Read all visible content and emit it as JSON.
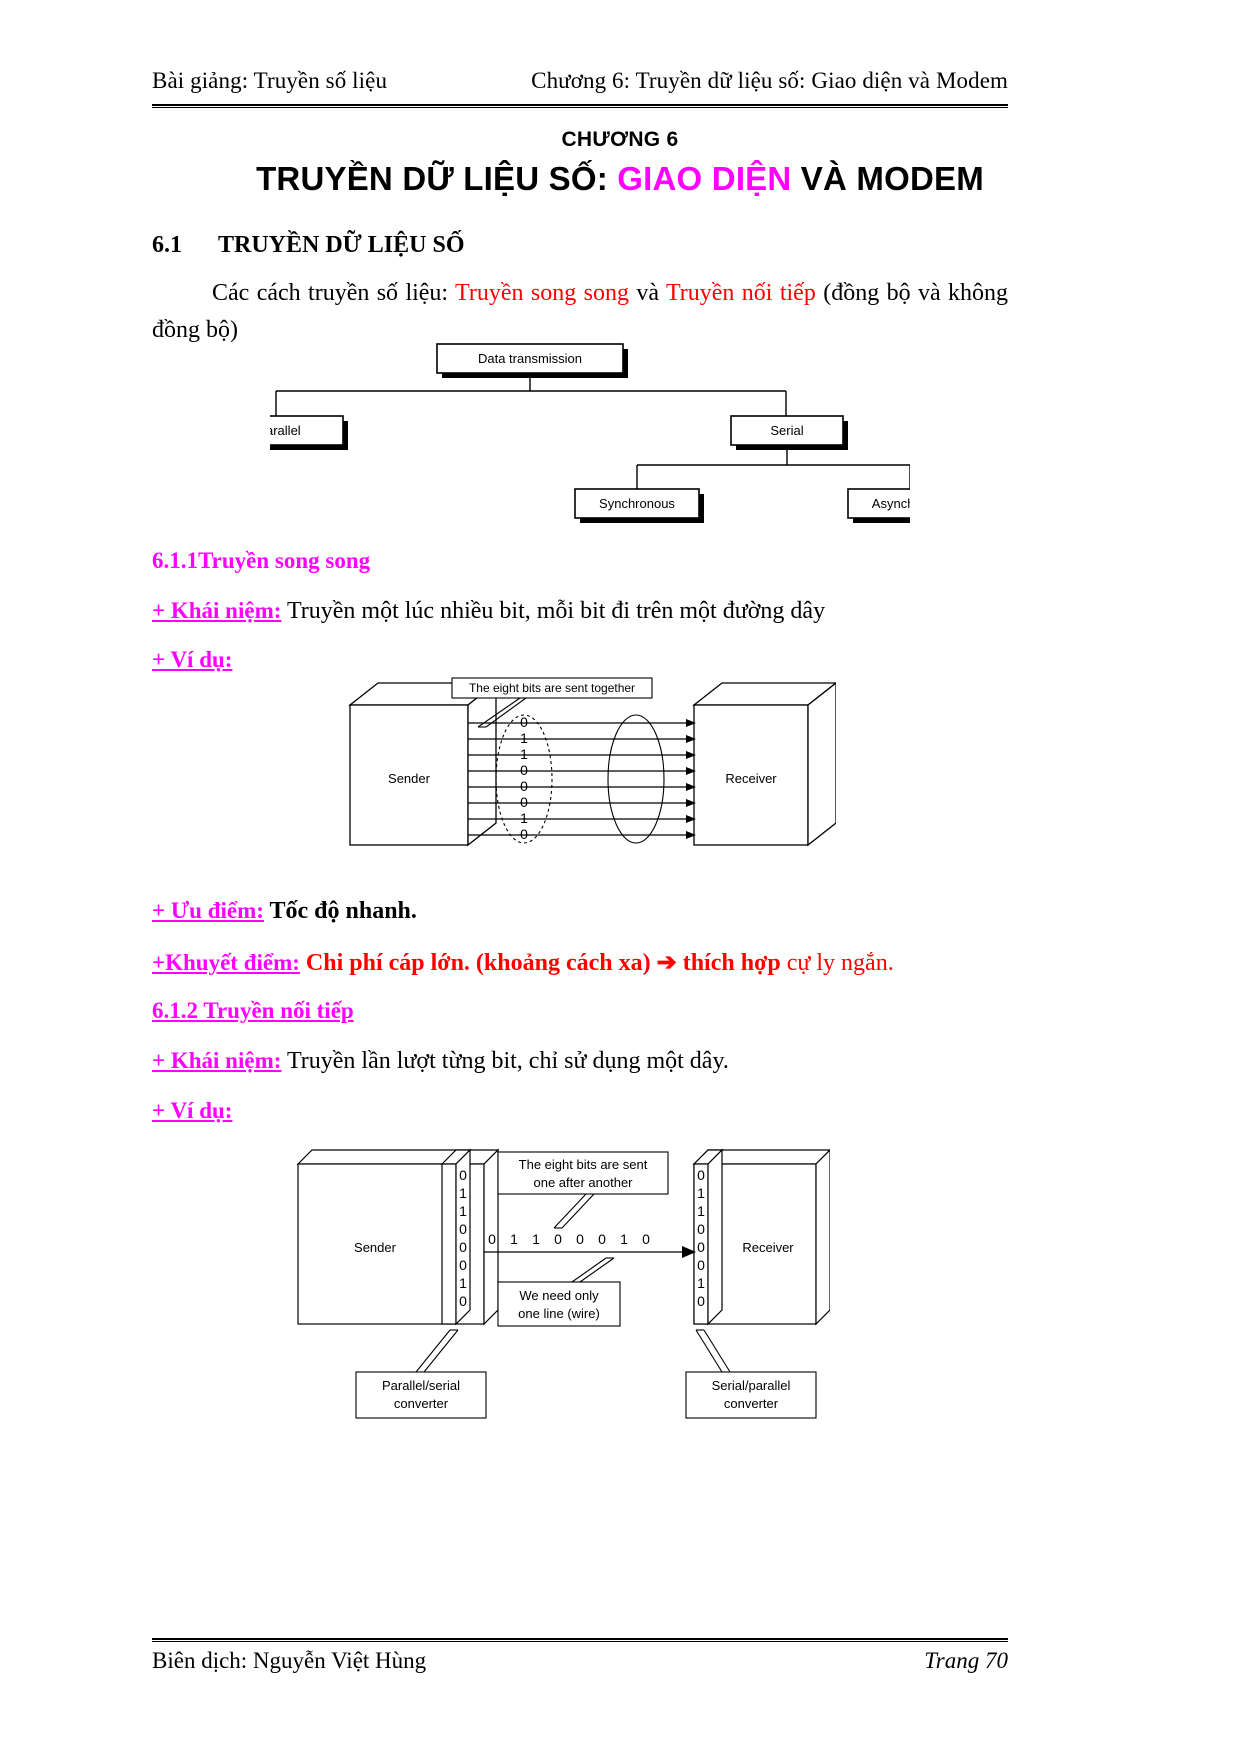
{
  "header": {
    "left": "Bài giảng: Truyền số liệu",
    "right": "Chương 6: Truyền dữ liệu số: Giao diện và Modem"
  },
  "footer": {
    "left": "Biên dịch: Nguyễn Việt Hùng",
    "right": "Trang 70"
  },
  "title": {
    "kicker": "CHƯƠNG 6",
    "main_part1": "TRUYỀN DỮ LIỆU SỐ: ",
    "main_highlight": "GIAO DIỆN",
    "main_part2": " VÀ MODEM",
    "highlight_color": "#ff00ff"
  },
  "section_61": {
    "number": "6.1",
    "heading": "TRUYỀN DỮ LIỆU SỐ",
    "intro_a": "Các cách truyền số liệu: ",
    "intro_red1": "Truyền song song",
    "intro_b": "  và ",
    "intro_red2": "Truyền nối tiếp",
    "intro_c": " (đồng bộ và không đồng bộ)"
  },
  "fig_tree": {
    "root": "Data transmission",
    "left": "Parallel",
    "right": "Serial",
    "child_left": "Synchronous",
    "child_right": "Asynchronous"
  },
  "section_611": {
    "heading": "6.1.1Truyền song song",
    "concept_label": "+ Khái niệm:",
    "concept_text": " Truyền một lúc nhiều bit, mỗi bit đi trên một đường dây",
    "example_label": "+ Ví dụ:",
    "advantage_label": "+ Ưu điểm:",
    "advantage_text": " Tốc độ nhanh.",
    "drawback_label": "+Khuyết điểm:",
    "drawback_text_bold": " Chi phí cáp lớn. (khoảng cách xa) ",
    "drawback_arrow": "➔",
    "drawback_text_bold2": " thích hợp ",
    "drawback_text_red": "cự ly ngắn."
  },
  "fig_parallel": {
    "callout": "The eight bits are sent together",
    "sender": "Sender",
    "receiver": "Receiver",
    "bits": [
      "0",
      "1",
      "1",
      "0",
      "0",
      "0",
      "1",
      "0"
    ]
  },
  "section_612": {
    "heading": "6.1.2 Truyền nối tiếp",
    "concept_label": "+ Khái niệm:",
    "concept_text": "  Truyền lần lượt từng bit, chỉ sử dụng một dây.",
    "example_label": "+ Ví dụ:"
  },
  "fig_serial": {
    "callout_line1": "The eight bits are sent",
    "callout_line2": "one after another",
    "note_line1": "We need only",
    "note_line2": "one line (wire)",
    "sender": "Sender",
    "receiver": "Receiver",
    "bits": [
      "0",
      "1",
      "1",
      "0",
      "0",
      "0",
      "1",
      "0"
    ],
    "stream": [
      "0",
      "1",
      "1",
      "0",
      "0",
      "0",
      "1",
      "0"
    ],
    "conv_left_line1": "Parallel/serial",
    "conv_left_line2": "converter",
    "conv_right_line1": "Serial/parallel",
    "conv_right_line2": "converter"
  }
}
